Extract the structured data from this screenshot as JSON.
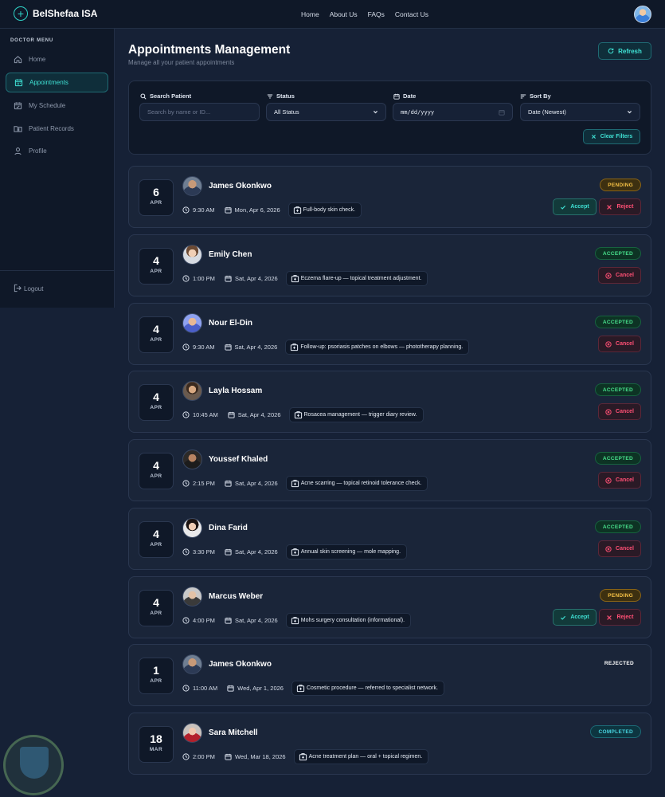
{
  "app": {
    "name": "BelShefaa ISA"
  },
  "topnav": [
    {
      "label": "Home"
    },
    {
      "label": "About Us"
    },
    {
      "label": "FAQs"
    },
    {
      "label": "Contact Us"
    }
  ],
  "sidebar": {
    "heading": "DOCTOR MENU",
    "items": [
      {
        "label": "Home",
        "icon": "home-icon"
      },
      {
        "label": "Appointments",
        "icon": "calendar-icon",
        "active": true
      },
      {
        "label": "My Schedule",
        "icon": "calendar-check-icon"
      },
      {
        "label": "Patient Records",
        "icon": "folder-user-icon"
      },
      {
        "label": "Profile",
        "icon": "user-icon"
      }
    ],
    "logout": "Logout"
  },
  "header": {
    "title": "Appointments Management",
    "subtitle": "Manage all your patient appointments",
    "refresh": "Refresh"
  },
  "filters": {
    "search_label": "Search Patient",
    "search_placeholder": "Search by name or ID...",
    "status_label": "Status",
    "status_value": "All Status",
    "date_label": "Date",
    "date_value": "mm/dd/yyyy",
    "sort_label": "Sort By",
    "sort_value": "Date (Newest)",
    "clear": "Clear Filters"
  },
  "labels": {
    "accept": "Accept",
    "reject": "Reject",
    "cancel": "Cancel"
  },
  "appointments": [
    {
      "day": "6",
      "month": "APR",
      "name": "James Okonkwo",
      "time": "9:30 AM",
      "date": "Mon, Apr 6, 2026",
      "note": "Full-body skin check.",
      "status": "PENDING"
    },
    {
      "day": "4",
      "month": "APR",
      "name": "Emily Chen",
      "time": "1:00 PM",
      "date": "Sat, Apr 4, 2026",
      "note": "Eczema flare-up — topical treatment adjustment.",
      "status": "ACCEPTED"
    },
    {
      "day": "4",
      "month": "APR",
      "name": "Nour El-Din",
      "time": "9:30 AM",
      "date": "Sat, Apr 4, 2026",
      "note": "Follow-up: psoriasis patches on elbows — phototherapy planning.",
      "status": "ACCEPTED"
    },
    {
      "day": "4",
      "month": "APR",
      "name": "Layla Hossam",
      "time": "10:45 AM",
      "date": "Sat, Apr 4, 2026",
      "note": "Rosacea management — trigger diary review.",
      "status": "ACCEPTED"
    },
    {
      "day": "4",
      "month": "APR",
      "name": "Youssef Khaled",
      "time": "2:15 PM",
      "date": "Sat, Apr 4, 2026",
      "note": "Acne scarring — topical retinoid tolerance check.",
      "status": "ACCEPTED"
    },
    {
      "day": "4",
      "month": "APR",
      "name": "Dina Farid",
      "time": "3:30 PM",
      "date": "Sat, Apr 4, 2026",
      "note": "Annual skin screening — mole mapping.",
      "status": "ACCEPTED"
    },
    {
      "day": "4",
      "month": "APR",
      "name": "Marcus Weber",
      "time": "4:00 PM",
      "date": "Sat, Apr 4, 2026",
      "note": "Mohs surgery consultation (informational).",
      "status": "PENDING"
    },
    {
      "day": "1",
      "month": "APR",
      "name": "James Okonkwo",
      "time": "11:00 AM",
      "date": "Wed, Apr 1, 2026",
      "note": "Cosmetic procedure — referred to specialist network.",
      "status": "REJECTED"
    },
    {
      "day": "18",
      "month": "MAR",
      "name": "Sara Mitchell",
      "time": "2:00 PM",
      "date": "Wed, Mar 18, 2026",
      "note": "Acne treatment plan — oral + topical regimen.",
      "status": "COMPLETED"
    }
  ],
  "colors": {
    "accent": "#3fe0d3",
    "pending": "#f5c145",
    "accepted": "#48e08c",
    "danger": "#ff4f74",
    "completed": "#48d4e0"
  }
}
